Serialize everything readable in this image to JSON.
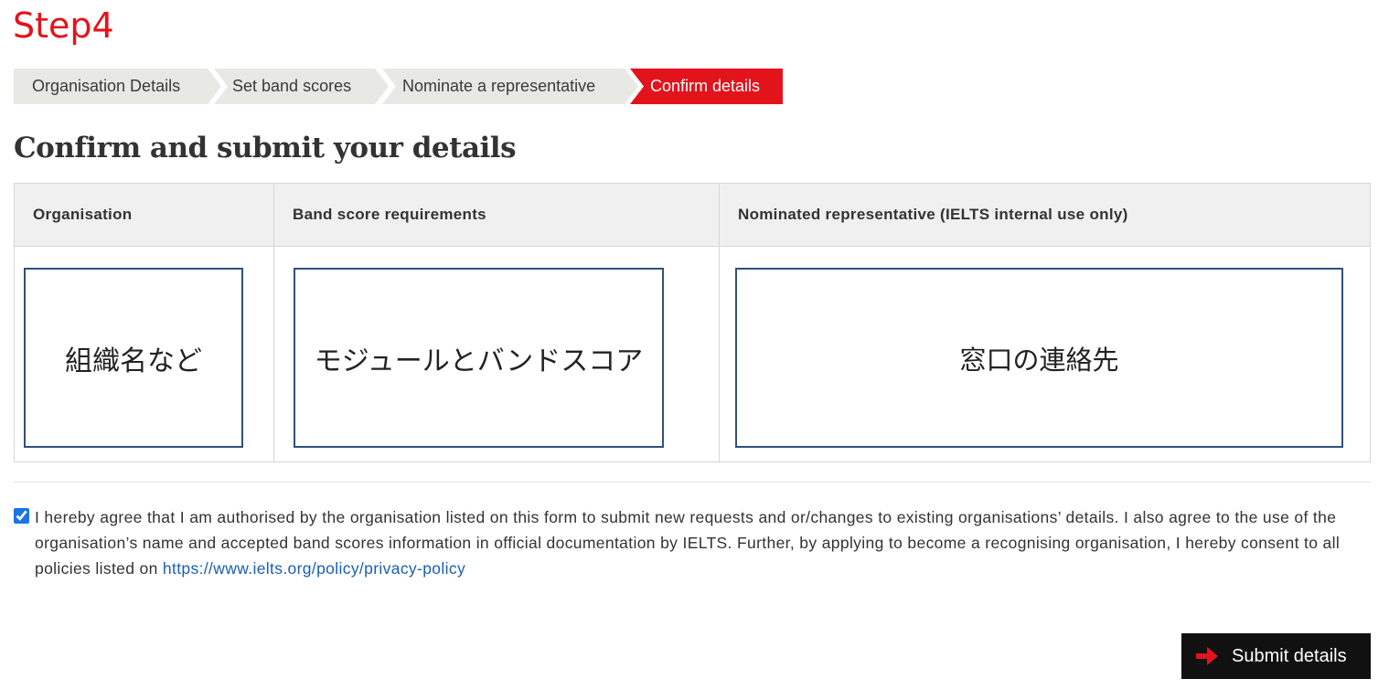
{
  "page": {
    "step_title": "Step4",
    "section_heading": "Confirm and submit your details"
  },
  "stepper": {
    "steps": [
      {
        "label": "Organisation Details",
        "active": false
      },
      {
        "label": "Set band scores",
        "active": false
      },
      {
        "label": "Nominate a representative",
        "active": false
      },
      {
        "label": "Confirm details",
        "active": true
      }
    ]
  },
  "table": {
    "headers": {
      "organisation": "Organisation",
      "band_scores": "Band score requirements",
      "representative": "Nominated representative (IELTS internal use only)"
    },
    "cells": {
      "organisation": "組織名など",
      "band_scores": "モジュールとバンドスコア",
      "representative": "窓口の連絡先"
    }
  },
  "consent": {
    "checked": true,
    "text": "I hereby agree that I am authorised by the organisation listed on this form to submit new requests and or/changes to existing organisations’ details. I also agree to the use of the organisation’s name and accepted band scores information in official documentation by IELTS. Further, by applying to become a recognising organisation, I hereby consent to all policies listed on ",
    "link_text": "https://www.ielts.org/policy/privacy-policy"
  },
  "submit": {
    "label": "Submit details",
    "icon": "arrow-right-icon"
  },
  "colors": {
    "brand_red": "#e3131b",
    "step_inactive": "#e8e8e4",
    "cell_border": "#2f4f80",
    "link": "#1a5fb4",
    "button_bg": "#111111"
  }
}
